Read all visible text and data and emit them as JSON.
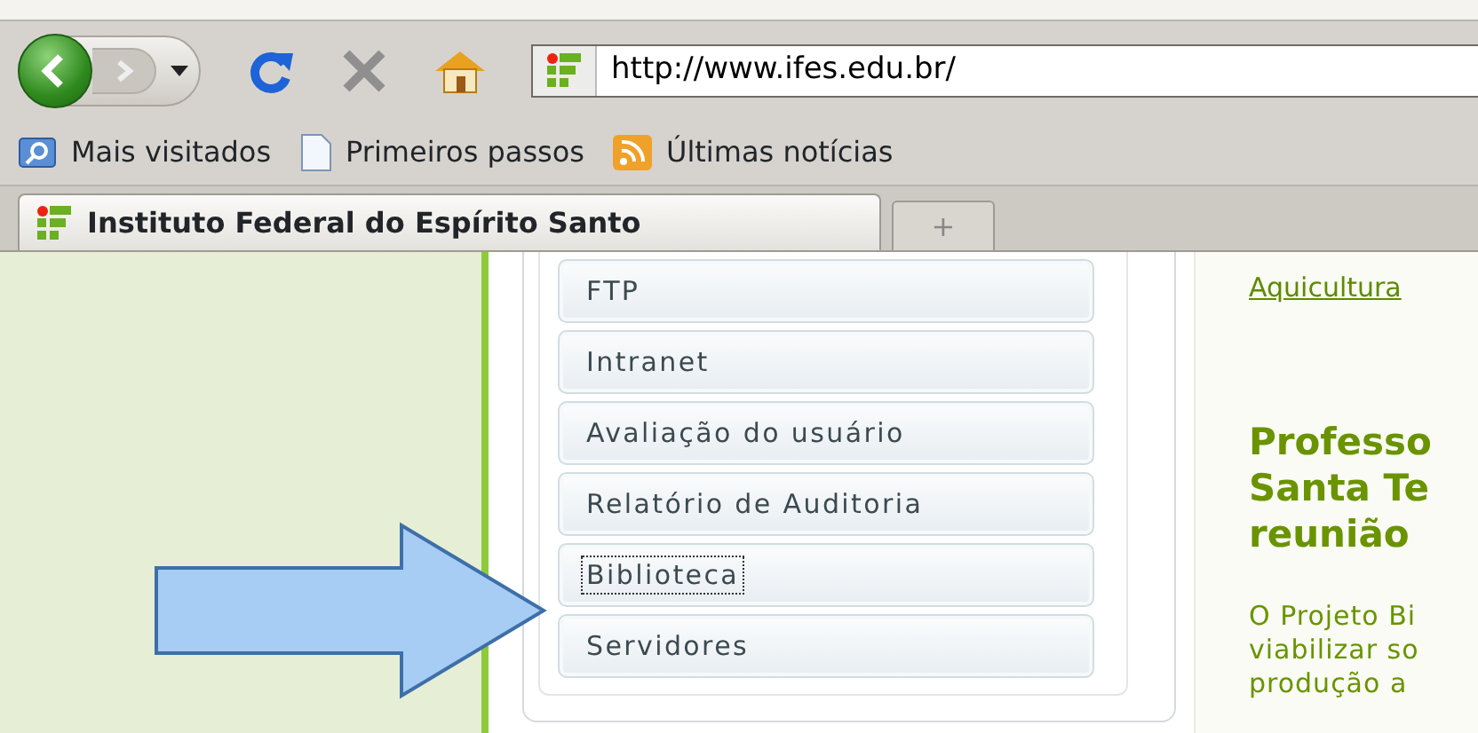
{
  "toolbar": {
    "url": "http://www.ifes.edu.br/"
  },
  "bookmarks": [
    {
      "label": "Mais visitados",
      "kind": "search"
    },
    {
      "label": "Primeiros passos",
      "kind": "page"
    },
    {
      "label": "Últimas notícias",
      "kind": "feed"
    }
  ],
  "tabs": [
    {
      "label": "Instituto Federal do Espírito Santo",
      "selected": true
    }
  ],
  "new_tab": {
    "label": "+"
  },
  "menu": [
    {
      "label": "FTP",
      "focused": false
    },
    {
      "label": "Intranet",
      "focused": false
    },
    {
      "label": "Avaliação do usuário",
      "focused": false
    },
    {
      "label": "Relatório de Auditoria",
      "focused": false
    },
    {
      "label": "Biblioteca",
      "focused": true
    },
    {
      "label": "Servidores",
      "focused": false
    }
  ],
  "news": {
    "link": "Aquicultura",
    "heading": [
      "Professo",
      "Santa Te",
      "reunião"
    ],
    "text": [
      "O Projeto Bi",
      "viabilizar so",
      "produção a"
    ]
  }
}
